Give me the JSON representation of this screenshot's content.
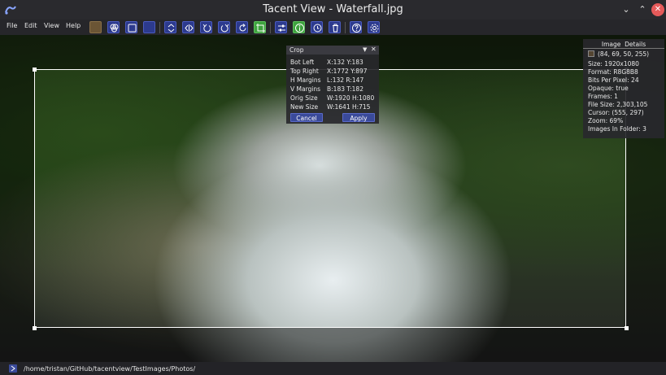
{
  "window": {
    "title": "Tacent View - Waterfall.jpg"
  },
  "menu": {
    "items": [
      "File",
      "Edit",
      "View",
      "Help"
    ]
  },
  "toolbar": {
    "buttons": [
      "color-swatch",
      "channels-icon",
      "tile-icon",
      "background-icon",
      "flip-vertical-icon",
      "flip-horizontal-icon",
      "rotate-left-icon",
      "rotate-right-icon",
      "refresh-icon",
      "crop-icon",
      "adjust-icon",
      "info-icon",
      "cycle-icon",
      "delete-icon",
      "help-icon",
      "settings-icon"
    ],
    "colors": {
      "blue": "#2c3a8e",
      "green": "#3ea33e",
      "swatch": "#6b5535"
    }
  },
  "crop": {
    "title": "Crop",
    "rows": [
      {
        "label": "Bot Left",
        "value": "X:132 Y:183"
      },
      {
        "label": "Top Right",
        "value": "X:1772 Y:897"
      },
      {
        "label": "H Margins",
        "value": "L:132 R:147"
      },
      {
        "label": "V Margins",
        "value": "B:183 T:182"
      },
      {
        "label": "Orig Size",
        "value": "W:1920 H:1080"
      },
      {
        "label": "New Size",
        "value": "W:1641 H:715"
      }
    ],
    "cancel_label": "Cancel",
    "apply_label": "Apply"
  },
  "details": {
    "header": "Image  Details",
    "color_value": "(84, 69, 50, 255)",
    "swatch_color": "#544532",
    "lines": [
      "Size: 1920x1080",
      "Format: R8G8B8",
      "Bits Per Pixel: 24",
      "Opaque: true",
      "Frames: 1",
      "File Size: 2,303,105",
      "Cursor: (555, 297)",
      "Zoom: 69%",
      "Images In Folder: 3"
    ]
  },
  "status": {
    "path": "/home/tristan/GitHub/tacentview/TestImages/Photos/"
  }
}
